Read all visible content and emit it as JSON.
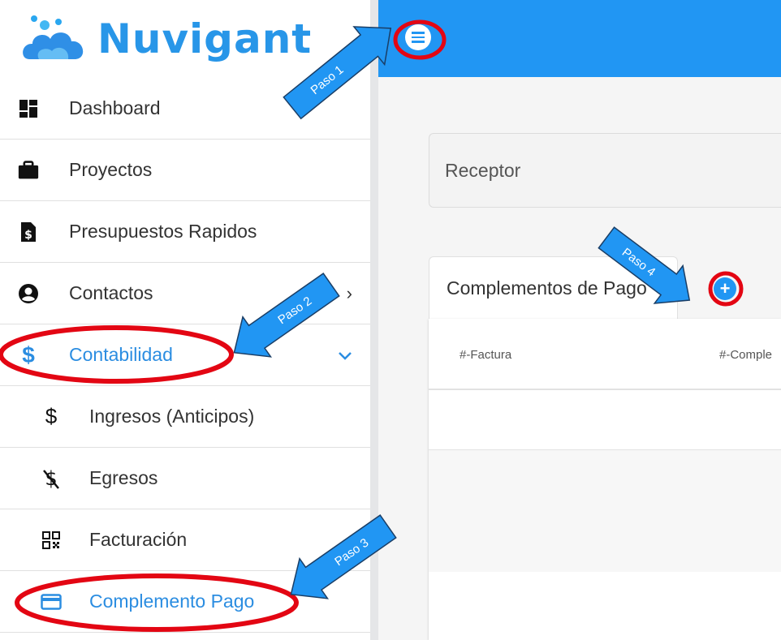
{
  "brand": {
    "name": "Nuvigant",
    "color": "#2896e8"
  },
  "sidebar": {
    "items": [
      {
        "label": "Dashboard",
        "icon": "dashboard-icon"
      },
      {
        "label": "Proyectos",
        "icon": "briefcase-icon"
      },
      {
        "label": "Presupuestos Rapidos",
        "icon": "invoice-dollar-icon"
      },
      {
        "label": "Contactos",
        "icon": "user-circle-icon",
        "chevron": "›"
      },
      {
        "label": "Contabilidad",
        "icon": "dollar-icon",
        "chevron": "⌄",
        "active": true
      },
      {
        "label": "Ingresos (Anticipos)",
        "icon": "dollar-icon",
        "sub": true
      },
      {
        "label": "Egresos",
        "icon": "dollar-slash-icon",
        "sub": true
      },
      {
        "label": "Facturación",
        "icon": "qr-code-icon",
        "sub": true
      },
      {
        "label": "Complemento Pago",
        "icon": "credit-card-icon",
        "sub": true,
        "active": true
      }
    ]
  },
  "topbar": {
    "menu_icon": "hamburger-menu-icon",
    "color": "#2196f3"
  },
  "main": {
    "receptor_label": "Receptor",
    "complementos_tab": "Complementos de Pago",
    "add_button": "+",
    "table": {
      "columns": [
        "#-Factura",
        "#-Comple"
      ]
    }
  },
  "annotations": {
    "steps": [
      "Paso 1",
      "Paso 2",
      "Paso 3",
      "Paso 4"
    ],
    "highlight_color": "#e30613",
    "arrow_color": "#2196f3"
  }
}
